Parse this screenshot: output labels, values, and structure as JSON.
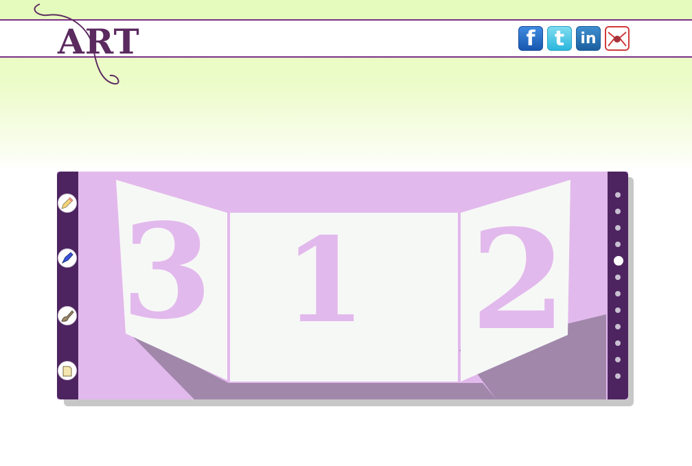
{
  "header": {
    "logo_text": "ART"
  },
  "social": [
    {
      "name": "facebook",
      "glyph": "f"
    },
    {
      "name": "twitter",
      "glyph": "t"
    },
    {
      "name": "linkedin",
      "glyph": "in"
    },
    {
      "name": "email",
      "icon": "envelope-icon"
    }
  ],
  "tools": [
    {
      "icon": "pencil-icon"
    },
    {
      "icon": "pen-icon"
    },
    {
      "icon": "brush-icon"
    },
    {
      "icon": "folder-icon"
    }
  ],
  "panels": {
    "left_number": "3",
    "center_number": "1",
    "right_number": "2"
  },
  "pagination": {
    "total": 12,
    "active_index": 4
  },
  "colors": {
    "brand_purple": "#4d2460",
    "lavender": "#e2b9ec",
    "header_green": "#e5fbbd",
    "panel_white": "#f6f8f6"
  }
}
